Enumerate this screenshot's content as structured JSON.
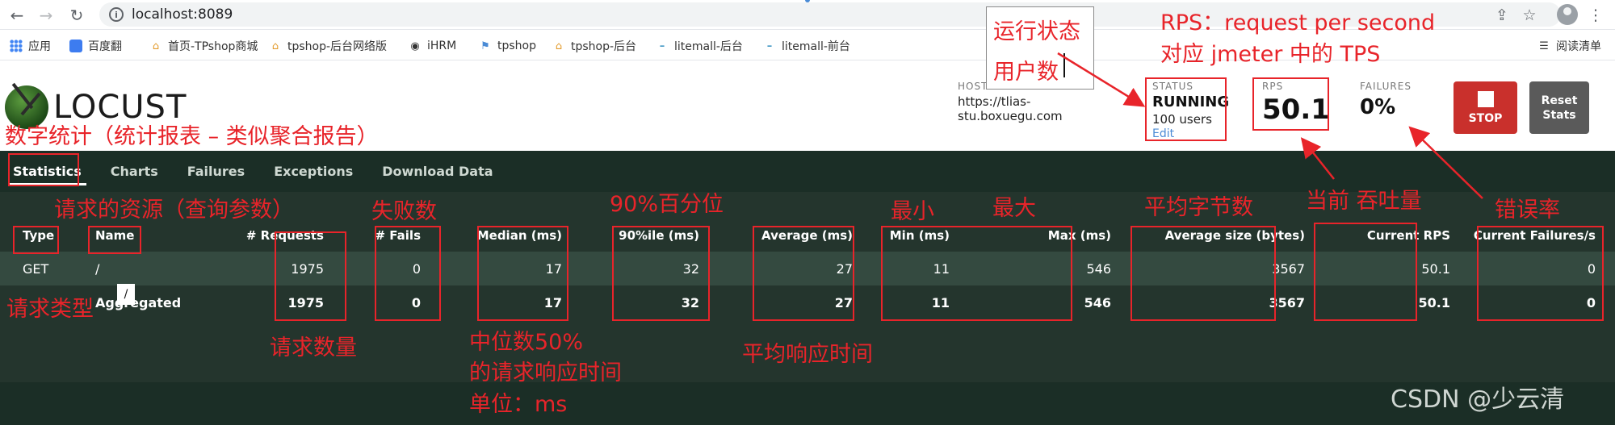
{
  "browser": {
    "url": "localhost:8089",
    "bookmarks": [
      {
        "label": "应用",
        "icon": "apps-grid-icon"
      },
      {
        "label": "百度翻",
        "icon": "translate-icon"
      },
      {
        "label": "首页-TPshop商城",
        "icon": "house-icon"
      },
      {
        "label": "tpshop-后台网络版",
        "icon": "house-icon"
      },
      {
        "label": "iHRM",
        "icon": "globe-icon"
      },
      {
        "label": "tpshop",
        "icon": "flag-icon"
      },
      {
        "label": "tpshop-后台",
        "icon": "house-icon"
      },
      {
        "label": "litemall-后台",
        "icon": "dash-icon"
      },
      {
        "label": "litemall-前台",
        "icon": "dash-icon"
      }
    ],
    "reading_list": "阅读清单"
  },
  "locust": {
    "logo_text": "LOCUST",
    "host_label": "HOST",
    "host_value": "https://tlias-stu.boxuegu.com",
    "status_label": "STATUS",
    "status_value": "RUNNING",
    "users": "100 users",
    "edit": "Edit",
    "rps_label": "RPS",
    "rps_value": "50.1",
    "failures_label": "FAILURES",
    "failures_value": "0%",
    "stop_label": "STOP",
    "reset_label": "Reset Stats",
    "tabs": [
      "Statistics",
      "Charts",
      "Failures",
      "Exceptions",
      "Download Data"
    ],
    "active_tab": "Statistics",
    "columns": [
      "Type",
      "Name",
      "# Requests",
      "# Fails",
      "Median (ms)",
      "90%ile (ms)",
      "Average (ms)",
      "Min (ms)",
      "Max (ms)",
      "Average size (bytes)",
      "Current RPS",
      "Current Failures/s"
    ],
    "rows": [
      {
        "type": "GET",
        "name": "/",
        "requests": "1975",
        "fails": "0",
        "median": "17",
        "p90": "32",
        "average": "27",
        "min": "11",
        "max": "546",
        "avg_size": "3567",
        "current_rps": "50.1",
        "current_failures": "0"
      },
      {
        "type": "",
        "name": "Aggregated",
        "requests": "1975",
        "fails": "0",
        "median": "17",
        "p90": "32",
        "average": "27",
        "min": "11",
        "max": "546",
        "avg_size": "3567",
        "current_rps": "50.1",
        "current_failures": "0"
      }
    ],
    "cursor_glyph": "/"
  },
  "annotations": {
    "note_line1": "运行状态",
    "note_line2": "用户数",
    "rps_line1": "RPS：request per second",
    "rps_line2": "对应 jmeter 中的 TPS",
    "stats_title": "数字统计（统计报表 – 类似聚合报告）",
    "name_note": "请求的资源（查询参数）",
    "fails_note": "失败数",
    "p90_note": "90%百分位",
    "min_note": "最小",
    "max_note": "最大",
    "avg_size_note": "平均字节数",
    "rps_note": "当前 吞吐量",
    "fail_rate_note": "错误率",
    "type_note": "请求类型",
    "requests_note": "请求数量",
    "median_note_1": "中位数50%",
    "median_note_2": "的请求响应时间",
    "median_note_3": "单位：ms",
    "avg_note": "平均响应时间",
    "accent_color": "#e8242a"
  },
  "watermark": "CSDN @少云清"
}
